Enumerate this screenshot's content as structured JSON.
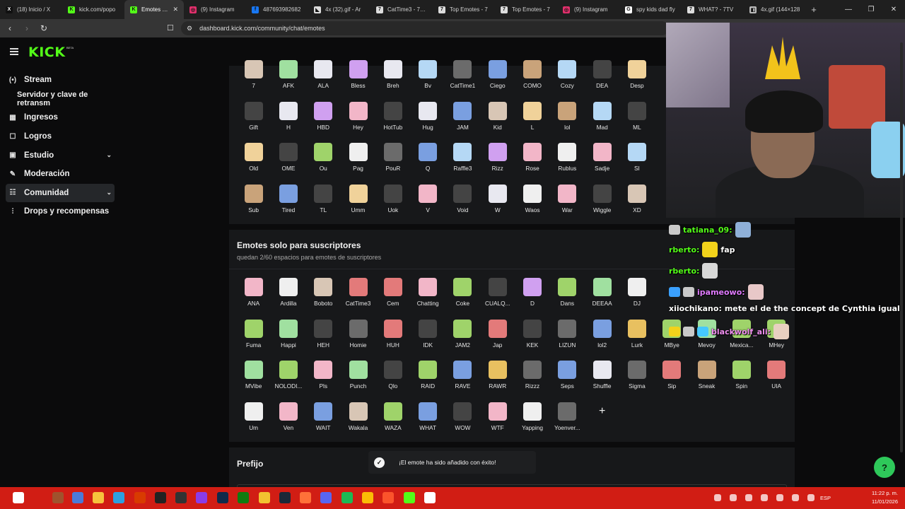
{
  "browser": {
    "tabs": [
      {
        "label": "(18) Inicio / X",
        "fav": "X",
        "color": "#111111",
        "active": false
      },
      {
        "label": "kick.com/popo",
        "fav": "K",
        "color": "#53fc18",
        "active": false
      },
      {
        "label": "Emotes - K",
        "fav": "K",
        "color": "#53fc18",
        "active": true
      },
      {
        "label": "(9) Instagram",
        "fav": "◎",
        "color": "#e1306c",
        "active": false
      },
      {
        "label": "487693982682",
        "fav": "f",
        "color": "#1877f2",
        "active": false
      },
      {
        "label": "4x (32).gif - Ar",
        "fav": "◣",
        "color": "#dddddd",
        "active": false
      },
      {
        "label": "CatTime3 - 7TV",
        "fav": "7",
        "color": "#dddddd",
        "active": false
      },
      {
        "label": "Top Emotes - 7",
        "fav": "7",
        "color": "#dddddd",
        "active": false
      },
      {
        "label": "Top Emotes - 7",
        "fav": "7",
        "color": "#dddddd",
        "active": false
      },
      {
        "label": "(9) Instagram",
        "fav": "◎",
        "color": "#e1306c",
        "active": false
      },
      {
        "label": "spy kids dad fly",
        "fav": "G",
        "color": "#ffffff",
        "active": false
      },
      {
        "label": "WHAT? - 7TV",
        "fav": "7",
        "color": "#dddddd",
        "active": false
      },
      {
        "label": "4x.gif (144×128",
        "fav": "◧",
        "color": "#bbbbbb",
        "active": false
      }
    ],
    "url": "dashboard.kick.com/community/chat/emotes"
  },
  "sidebar": {
    "items": [
      {
        "label": "Stream",
        "icon": "(•)",
        "type": "item"
      },
      {
        "label": "Servidor y clave de retransm",
        "icon": "",
        "type": "sub"
      },
      {
        "label": "Ingresos",
        "icon": "▦",
        "type": "item"
      },
      {
        "label": "Logros",
        "icon": "☐",
        "type": "item"
      },
      {
        "label": "Estudio",
        "icon": "▣",
        "type": "item",
        "chevron": "⌄"
      },
      {
        "label": "Moderación",
        "icon": "✎",
        "type": "item"
      },
      {
        "label": "Comunidad",
        "icon": "☷",
        "type": "item",
        "chevron": "⌄",
        "active": true
      },
      {
        "label": "Drops y recompensas",
        "icon": "⫶",
        "type": "item"
      }
    ]
  },
  "global_emotes": [
    "7",
    "AFK",
    "ALA",
    "Bless",
    "Breh",
    "Bv",
    "CatTime1",
    "Ciego",
    "COMO",
    "Cozy",
    "DEA",
    "Desp",
    "Gift",
    "H",
    "HBD",
    "Hey",
    "HotTub",
    "Hug",
    "JAM",
    "Kid",
    "L",
    "lol",
    "Mad",
    "ML",
    "Old",
    "OME",
    "Ou",
    "Pag",
    "PouR",
    "Q",
    "Raffle3",
    "Rizz",
    "Rose",
    "Rublus",
    "Sadje",
    "SI",
    "Sub",
    "Tired",
    "TL",
    "Umm",
    "Uok",
    "V",
    "Void",
    "W",
    "Waos",
    "War",
    "Wiggle",
    "XD"
  ],
  "subs_section": {
    "title": "Emotes solo para suscriptores",
    "subtitle": "quedan 2/60 espacios para emotes de suscriptores",
    "emotes": [
      "ANA",
      "Ardilla",
      "Boboto",
      "CatTime3",
      "Cem",
      "Chatting",
      "Coke",
      "CUALQ...",
      "D",
      "Dans",
      "DEEAA",
      "DJ",
      "Fuma",
      "Happi",
      "HEH",
      "Homie",
      "HUH",
      "IDK",
      "JAM2",
      "Jap",
      "KEK",
      "LIZUN",
      "lol2",
      "Lurk",
      "MBye",
      "Mevoy",
      "Mexica...",
      "MHey",
      "MVibe",
      "NOLODI...",
      "Pls",
      "Punch",
      "Qlo",
      "RAID",
      "RAVE",
      "RAWR",
      "Rizzz",
      "Seps",
      "Shuffle",
      "Sigma",
      "Sip",
      "Sneak",
      "Spin",
      "UIA",
      "Um",
      "Ven",
      "WAIT",
      "Wakala",
      "WAZA",
      "WHAT",
      "WOW",
      "WTF",
      "Yapping",
      "Yoenver..."
    ]
  },
  "prefix_section": {
    "title": "Prefijo"
  },
  "toast": {
    "message": "¡El emote ha sido añadido con éxito!"
  },
  "chat": [
    {
      "user": "tatiana_09:",
      "text": "",
      "color": "c-green"
    },
    {
      "user": "rberto:",
      "text": "fap",
      "color": "c-green"
    },
    {
      "user": "rberto:",
      "text": "",
      "color": "c-green"
    },
    {
      "user": "ipameowo:",
      "text": "",
      "color": "c-purple"
    },
    {
      "user": "xiiochikano:",
      "text": "mete el de the concept de Cynthia igual",
      "color": "c-white"
    },
    {
      "user": "blackwolf_ali:",
      "text": "",
      "color": "c-pink"
    }
  ],
  "taskbar": {
    "lang": "ESP",
    "time": "11:22 p. m.",
    "date": "11/01/2026"
  },
  "palette": {
    "kick_green": "#53fc18",
    "panel_bg": "#17181a",
    "page_bg": "#0b0b0c",
    "taskbar_red": "#d11d14"
  }
}
